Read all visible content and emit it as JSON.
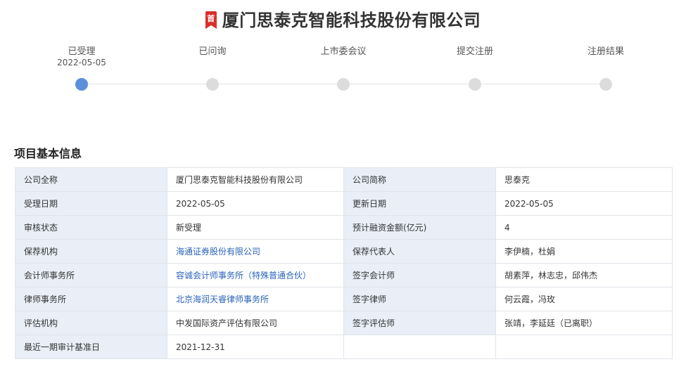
{
  "header": {
    "badge": "首",
    "title": "厦门思泰克智能科技股份有限公司"
  },
  "timeline": {
    "steps": [
      {
        "label": "已受理",
        "date": "2022-05-05",
        "active": true
      },
      {
        "label": "已问询",
        "date": "",
        "active": false
      },
      {
        "label": "上市委会议",
        "date": "",
        "active": false
      },
      {
        "label": "提交注册",
        "date": "",
        "active": false
      },
      {
        "label": "注册结果",
        "date": "",
        "active": false
      }
    ]
  },
  "section": {
    "title": "项目基本信息"
  },
  "info_rows": [
    {
      "l1": "公司全称",
      "v1": "厦门思泰克智能科技股份有限公司",
      "l2": "公司简称",
      "v2": "思泰克"
    },
    {
      "l1": "受理日期",
      "v1": "2022-05-05",
      "l2": "更新日期",
      "v2": "2022-05-05"
    },
    {
      "l1": "审核状态",
      "v1": "新受理",
      "l2": "预计融资金额(亿元)",
      "v2": "4"
    },
    {
      "l1": "保荐机构",
      "v1": "海通证券股份有限公司",
      "l2": "保荐代表人",
      "v2": "李伊楠，杜娟"
    },
    {
      "l1": "会计师事务所",
      "v1": "容诚会计师事务所（特殊普通合伙）",
      "l2": "签字会计师",
      "v2": "胡素萍，林志忠，邱伟杰"
    },
    {
      "l1": "律师事务所",
      "v1": "北京海润天睿律师事务所",
      "l2": "签字律师",
      "v2": "何云霞，冯玫"
    },
    {
      "l1": "评估机构",
      "v1": "中发国际资产评估有限公司",
      "l2": "签字评估师",
      "v2": "张靖，李延廷（已离职）"
    },
    {
      "l1": "最近一期审计基准日",
      "v1": "2021-12-31",
      "l2": "",
      "v2": ""
    }
  ]
}
